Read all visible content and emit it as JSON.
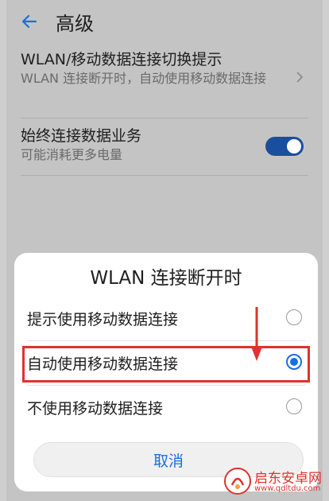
{
  "header": {
    "title": "高级"
  },
  "settings": [
    {
      "title": "WLAN/移动数据连接切换提示",
      "description": "WLAN 连接断开时，自动使用移动数据连接"
    },
    {
      "title": "始终连接数据业务",
      "description": "可能消耗更多电量",
      "toggle_on": true
    }
  ],
  "dialog": {
    "title": "WLAN 连接断开时",
    "options": [
      {
        "label": "提示使用移动数据连接",
        "selected": false
      },
      {
        "label": "自动使用移动数据连接",
        "selected": true
      },
      {
        "label": "不使用移动数据连接",
        "selected": false
      }
    ],
    "cancel_label": "取消"
  },
  "watermark": {
    "text": "启东安卓网",
    "url": "www.qdltdu.com"
  },
  "colors": {
    "accent": "#1a6fe0",
    "toggle": "#1a4f9e",
    "highlight": "#e0322e"
  }
}
